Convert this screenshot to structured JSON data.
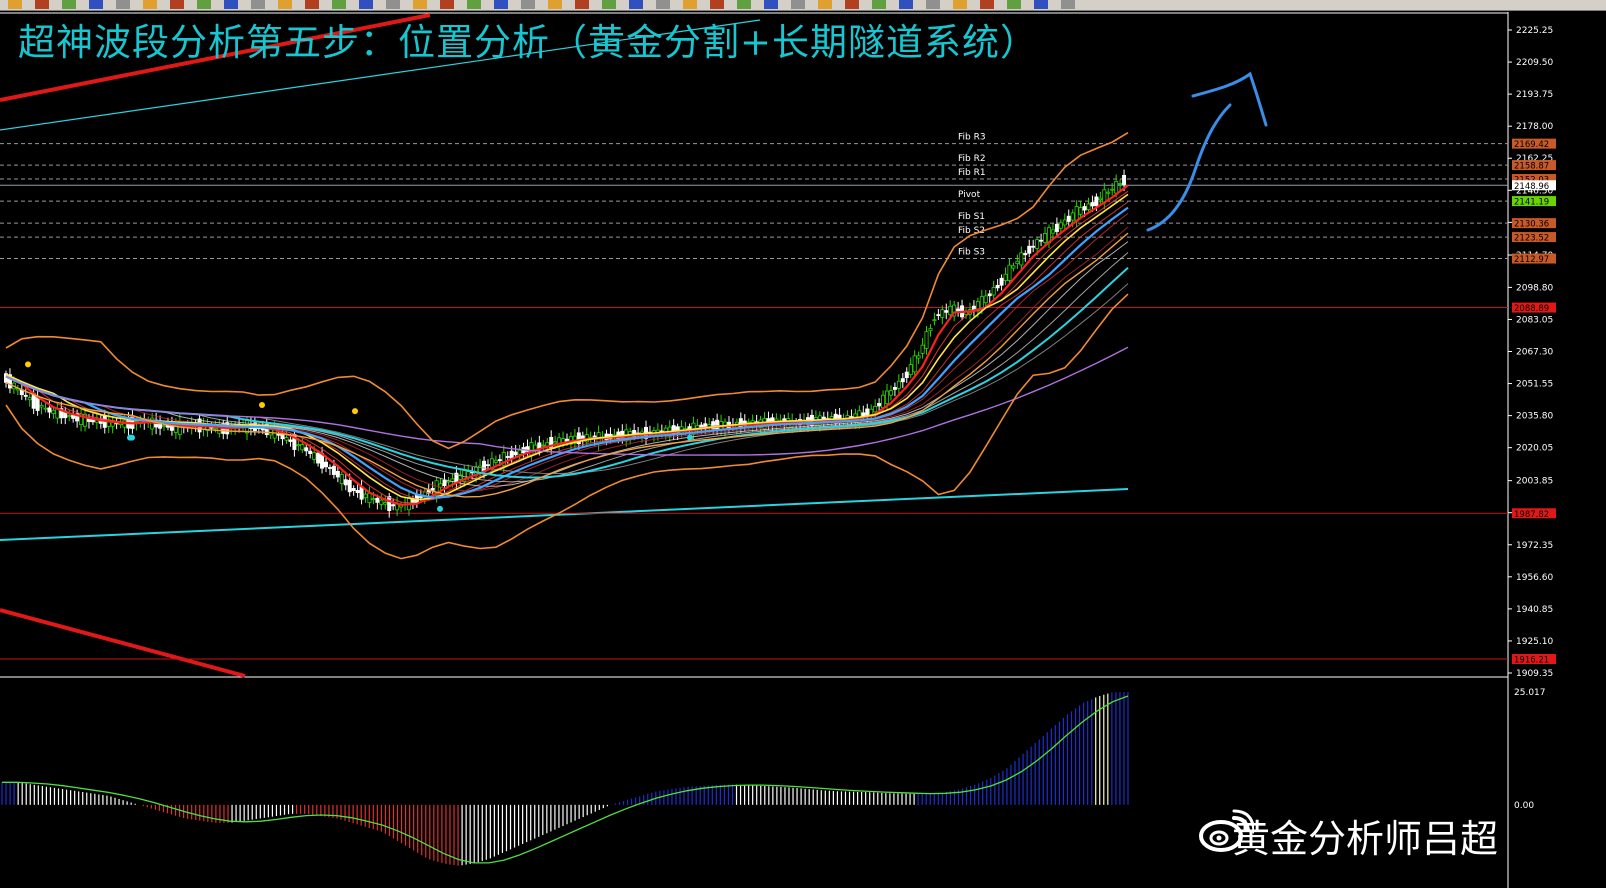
{
  "heading": "超神波段分析第五步：位置分析（黄金分割+长期隧道系统）",
  "watermark": "黄金分析师吕超",
  "watermark_icon": "weibo-icon",
  "colors": {
    "background": "#000000",
    "heading": "#16c6d0",
    "bull_candle": "#2bd400",
    "bear_candle": "#ffffff",
    "bollinger": "#f08a30",
    "short_ma": "#3fa3ff",
    "tunnel_line": "#2ad3e0",
    "trend_line": "#e01818",
    "level_line": "#c81414",
    "pivot_line": "#9a9a9a",
    "macd_up": "#1c2fd0",
    "macd_down": "#e03030",
    "macd_signal": "#4ee040",
    "arrow": "#3a8ee8"
  },
  "chart_data": [
    {
      "type": "line",
      "instrument": "XAUUSD (candlestick)",
      "y_ticks": [
        "2225.25",
        "2209.50",
        "2193.75",
        "2178.00",
        "2162.25",
        "2146.50",
        "2130.75",
        "2114.70",
        "2098.80",
        "2083.05",
        "2067.30",
        "2051.55",
        "2035.80",
        "2020.05",
        "2003.85",
        "1988.10",
        "1972.35",
        "1956.60",
        "1940.85",
        "1925.10",
        "1909.35"
      ],
      "ylim": [
        1909.35,
        2225.25
      ],
      "pivot_levels": [
        {
          "label": "Fib R3",
          "value": 2169.42
        },
        {
          "label": "Fib R2",
          "value": 2158.87
        },
        {
          "label": "Fib R1",
          "value": 2152.03
        },
        {
          "label": "Pivot",
          "value": 2141.19
        },
        {
          "label": "Fib S1",
          "value": 2130.36
        },
        {
          "label": "Fib S2",
          "value": 2123.52
        },
        {
          "label": "Fib S3",
          "value": 2112.97
        }
      ],
      "price_tags": [
        {
          "text": "2169.42",
          "value": 2169.42,
          "color": "#c85a28"
        },
        {
          "text": "2158.87",
          "value": 2158.87,
          "color": "#c85a28"
        },
        {
          "text": "2152.03",
          "value": 2152.03,
          "color": "#c85a28"
        },
        {
          "text": "2148.96",
          "value": 2148.96,
          "color": "#ffffff"
        },
        {
          "text": "2141.19",
          "value": 2141.19,
          "color": "#6ad400"
        },
        {
          "text": "2130.36",
          "value": 2130.36,
          "color": "#c85a28"
        },
        {
          "text": "2123.52",
          "value": 2123.52,
          "color": "#c85a28"
        },
        {
          "text": "2112.97",
          "value": 2112.97,
          "color": "#c85a28"
        },
        {
          "text": "2088.89",
          "value": 2088.89,
          "color": "#e01818"
        },
        {
          "text": "1987.82",
          "value": 1987.82,
          "color": "#e01818"
        },
        {
          "text": "1916.21",
          "value": 1916.21,
          "color": "#e01818"
        }
      ],
      "horizontal_levels": [
        2088.89,
        1987.82,
        1916.21
      ],
      "last_price": 2148.96,
      "price_path": [
        2055,
        2048,
        2042,
        2038,
        2036,
        2034,
        2033,
        2032,
        2032,
        2033,
        2031,
        2030,
        2031,
        2030,
        2029,
        2031,
        2030,
        2028,
        2024,
        2020,
        2014,
        2008,
        2000,
        1996,
        1993,
        1991,
        1994,
        1999,
        2003,
        2006,
        2009,
        2013,
        2016,
        2019,
        2021,
        2023,
        2024,
        2025,
        2025,
        2026,
        2027,
        2027,
        2028,
        2029,
        2030,
        2031,
        2031,
        2032,
        2032,
        2033,
        2032,
        2033,
        2034,
        2034,
        2035,
        2038,
        2046,
        2054,
        2066,
        2085,
        2088,
        2086,
        2092,
        2100,
        2110,
        2118,
        2124,
        2130,
        2136,
        2140,
        2146,
        2152
      ]
    },
    {
      "type": "bar",
      "indicator": "MACD histogram with signal line",
      "y_ticks": [
        "25.017",
        "0.00"
      ],
      "ylim": [
        -14,
        25.017
      ],
      "values": [
        5,
        5,
        4.5,
        4,
        3.5,
        3,
        2.5,
        2,
        1,
        0,
        -1,
        -2,
        -3,
        -3.5,
        -4,
        -4,
        -3.5,
        -3,
        -2.5,
        -2,
        -2,
        -2.5,
        -3,
        -4,
        -5,
        -6,
        -8,
        -10,
        -12,
        -13,
        -13.5,
        -13,
        -12,
        -10.5,
        -9,
        -7.5,
        -6,
        -4.5,
        -3,
        -1.5,
        0,
        1,
        2,
        3,
        3.5,
        4,
        4.2,
        4.4,
        4.5,
        4.4,
        4.2,
        4,
        3.8,
        3.5,
        3.2,
        3,
        2.9,
        2.8,
        2.6,
        2.5,
        2.4,
        2.5,
        2.8,
        3.5,
        4.5,
        6,
        8,
        11,
        14,
        17,
        20,
        22.5,
        24,
        25,
        25
      ]
    }
  ]
}
